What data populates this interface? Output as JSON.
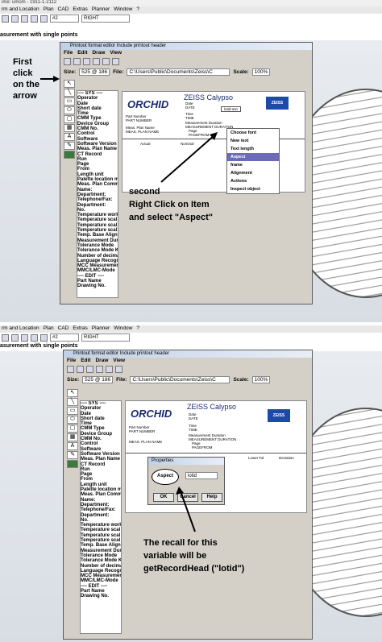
{
  "top": {
    "window_title": "ime: umom -  1911-1-2112",
    "menu": [
      "rm and Location",
      "Plan",
      "CAD",
      "Extras",
      "Planner",
      "Window",
      "?"
    ],
    "toolbar_select1": "#2",
    "toolbar_select2": "RIGHT",
    "subtitle": "asurement with single points",
    "editor_title": "Printout format editor  Include printout header",
    "editor_menu": [
      "File",
      "Edit",
      "Draw",
      "View"
    ],
    "size_label": "Size:",
    "size_value": "525 @ 186",
    "file_label": "File:",
    "file_value": "C:\\Users\\Public\\Documents\\Zeiss\\C",
    "scale_label": "Scale:",
    "scale_value": "100%",
    "annotation_first": [
      "First",
      "click",
      "on the",
      "arrow"
    ],
    "annotation_second": [
      "second",
      "Right Click on Item",
      "and select \"Aspect\""
    ],
    "context_menu": [
      "Choose font",
      "New text",
      "Text length",
      "Aspect",
      "frame",
      "Alignment",
      "Actions",
      "Inspect object"
    ],
    "context_highlight": "Aspect"
  },
  "bottom": {
    "menu": [
      "rm and Location",
      "Plan",
      "CAD",
      "Extras",
      "Planner",
      "Window",
      "?"
    ],
    "toolbar_select1": "#2",
    "toolbar_select2": "RIGHT",
    "subtitle": "asurement with single points",
    "editor_title": "Printout format editor  Include printout header",
    "editor_menu": [
      "File",
      "Edit",
      "Draw",
      "View"
    ],
    "size_label": "Size:",
    "size_value": "525 @ 186",
    "file_label": "File:",
    "file_value": "C:\\Users\\Public\\Documents\\Zeiss\\C",
    "scale_label": "Scale:",
    "scale_value": "100%",
    "dialog_title": "Properties",
    "aspect_label": "Aspect",
    "aspect_value": "lotid",
    "ok": "OK",
    "cancel": "Cancel",
    "help": "Help",
    "col_lower": "Lower Tol.",
    "col_dev": "Deviation",
    "annotation": [
      "The recall for this",
      "variable will be",
      "getRecordHead (\"lotid\")"
    ]
  },
  "variables_top": [
    "---- SYS ----",
    "Operator",
    "Date",
    "Short date",
    "Time",
    "CMM Type",
    "Device Group",
    "CMM No.",
    "Control",
    "Software",
    "Software Version",
    "Meas. Plan Name",
    "CT Record",
    "Run",
    "Page",
    "From",
    "Length unit",
    "Palette location m",
    "Meas. Plan Comm",
    "Name:",
    "Department:",
    "Telephone/Fax:",
    "Department:",
    "No.",
    "Temperature work",
    "Temperature scal",
    "Temperature scal",
    "Temperature scal",
    "Temp. Base Align",
    "Measurement Dur",
    "Tolerance Mode",
    "Tolerance Mode K",
    "Number of decima",
    "Language Recogn",
    "MCC Measuremer",
    "MMC/LMC-Mode",
    "---- EDIT ----",
    "Part Name",
    "Drawing No."
  ],
  "variables_bottom": [
    "---- SYS ----",
    "Operator",
    "Date",
    "Short date",
    "Time",
    "CMM Type",
    "Device Group",
    "CMM No.",
    "Control",
    "Software",
    "Software Version",
    "Meas. Plan Name",
    "CT Record",
    "Run",
    "Page",
    "From",
    "Length unit",
    "Palette location m",
    "Meas. Plan Comm",
    "Name:",
    "Department:",
    "Telephone/Fax:",
    "Department:",
    "No.",
    "Temperature work",
    "Temperature scal",
    "Temperature scal",
    "Temperature scal",
    "Temp. Base Align",
    "Measurement Dur",
    "Tolerance Mode",
    "Tolerance Mode K",
    "Number of decima",
    "Language Recogn",
    "MCC Measuremer",
    "MMC/LMC-Mode",
    "---- EDIT ----",
    "Part Name",
    "Drawing No."
  ],
  "header": {
    "logo": "ORCHID",
    "zeiss": "ZEISS  Calypso",
    "zeiss_logo": "ZEISS",
    "part_number_label": "Part Number",
    "part_number": "PART NUMBER",
    "meas_plan_label": "Meas. Plan Name",
    "meas_plan": "MEAS. PLAN NAME",
    "date_label": "Date",
    "date": "DATE",
    "time_label": "Time",
    "time": "TIME",
    "meas_dur_label": "Measurement Duration",
    "meas_dur": "MEASUREMENT DURATION",
    "page_label": "Page",
    "page_from": "PAGEFROM",
    "run": "RUN",
    "lotid": "lotid text",
    "actual": "Actual",
    "nominal": "Nominal"
  }
}
